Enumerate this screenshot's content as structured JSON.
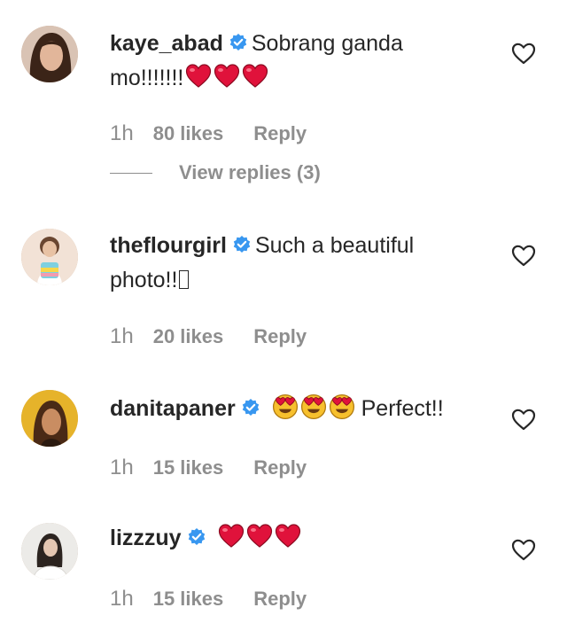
{
  "colors": {
    "text": "#262626",
    "muted": "#8e8e8e",
    "verified": "#3897f0",
    "heart": "#e0123b"
  },
  "comments": [
    {
      "username": "kaye_abad",
      "text_line1": "Sobrang ganda",
      "text_line2": "mo!!!!!!!",
      "emoji": [
        "red-heart",
        "red-heart",
        "red-heart"
      ],
      "time": "1h",
      "likes": "80 likes",
      "reply": "Reply",
      "view_replies": "View replies (3)"
    },
    {
      "username": "theflourgirl",
      "text_line1": "Such a beautiful",
      "text_line2": "photo!!",
      "emoji": [
        "missing-glyph"
      ],
      "time": "1h",
      "likes": "20 likes",
      "reply": "Reply"
    },
    {
      "username": "danitapaner",
      "text_line1": "Perfect!!",
      "emoji": [
        "heart-eyes-face",
        "heart-eyes-face",
        "heart-eyes-face"
      ],
      "time": "1h",
      "likes": "15 likes",
      "reply": "Reply"
    },
    {
      "username": "lizzzuy",
      "emoji": [
        "red-heart",
        "red-heart",
        "red-heart"
      ],
      "time": "1h",
      "likes": "15 likes",
      "reply": "Reply"
    }
  ]
}
